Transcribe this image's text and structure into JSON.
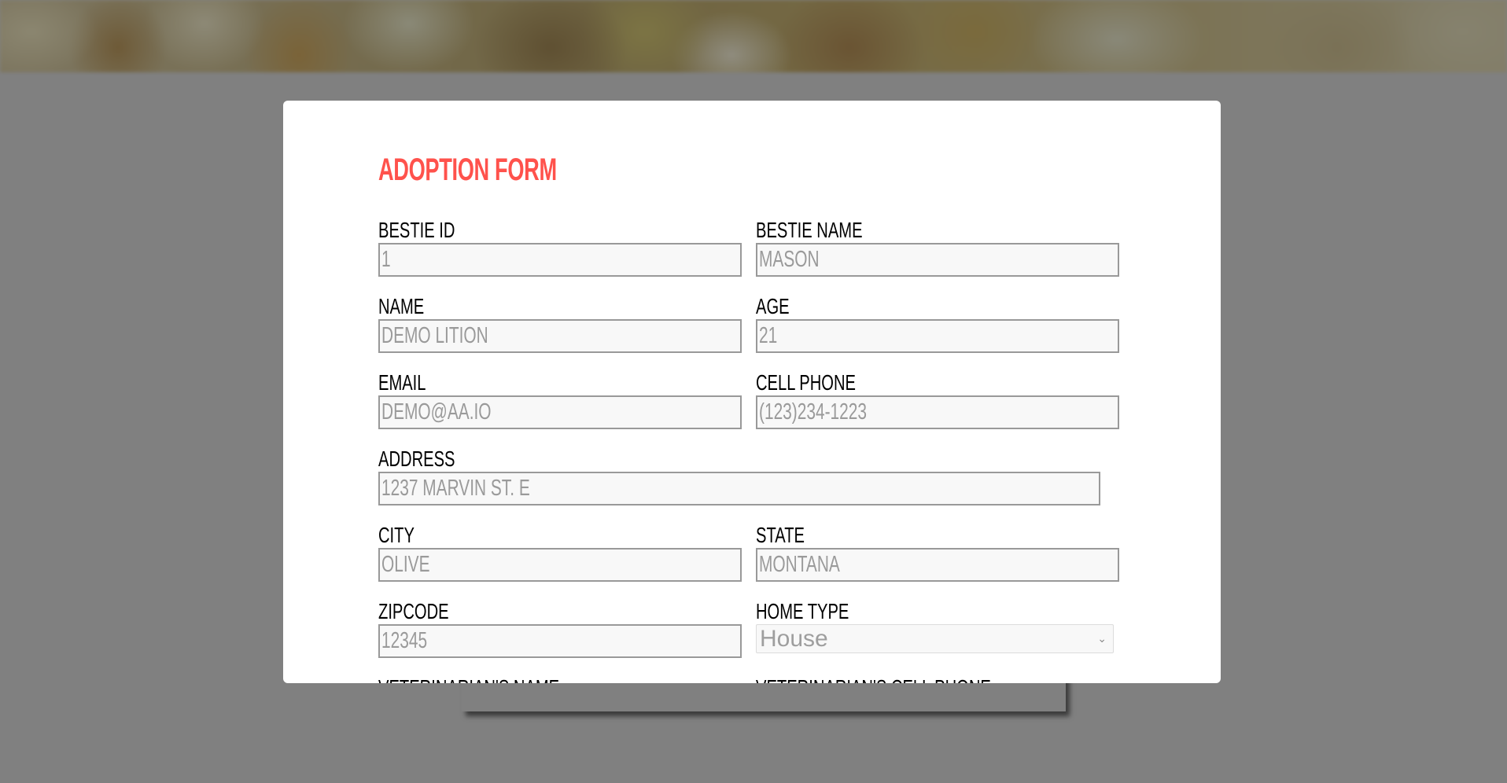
{
  "colors": {
    "overlay": "#808080",
    "title": "#ff524c",
    "input_bg": "#f8f8f8",
    "input_border": "#999999",
    "input_text": "#9a9a9a"
  },
  "modal": {
    "title": "ADOPTION FORM",
    "fields": {
      "bestie_id": {
        "label": "BESTIE ID",
        "value": "1"
      },
      "bestie_name": {
        "label": "BESTIE NAME",
        "value": "MASON"
      },
      "name": {
        "label": "NAME",
        "value": "DEMO LITION"
      },
      "age": {
        "label": "AGE",
        "value": "21"
      },
      "email": {
        "label": "EMAIL",
        "value": "DEMO@AA.IO"
      },
      "cell_phone": {
        "label": "CELL PHONE",
        "value": "(123)234-1223"
      },
      "address": {
        "label": "ADDRESS",
        "value": "1237 MARVIN ST. E"
      },
      "city": {
        "label": "CITY",
        "value": "OLIVE"
      },
      "state": {
        "label": "STATE",
        "value": "MONTANA"
      },
      "zipcode": {
        "label": "ZIPCODE",
        "value": "12345"
      },
      "home_type": {
        "label": "HOME TYPE",
        "value": "House",
        "icon": "chevron-down-icon"
      },
      "vet_name": {
        "label": "VETERINARIAN'S NAME"
      },
      "vet_cell_phone": {
        "label": "VETERINARIAN'S CELL PHONE"
      }
    }
  }
}
